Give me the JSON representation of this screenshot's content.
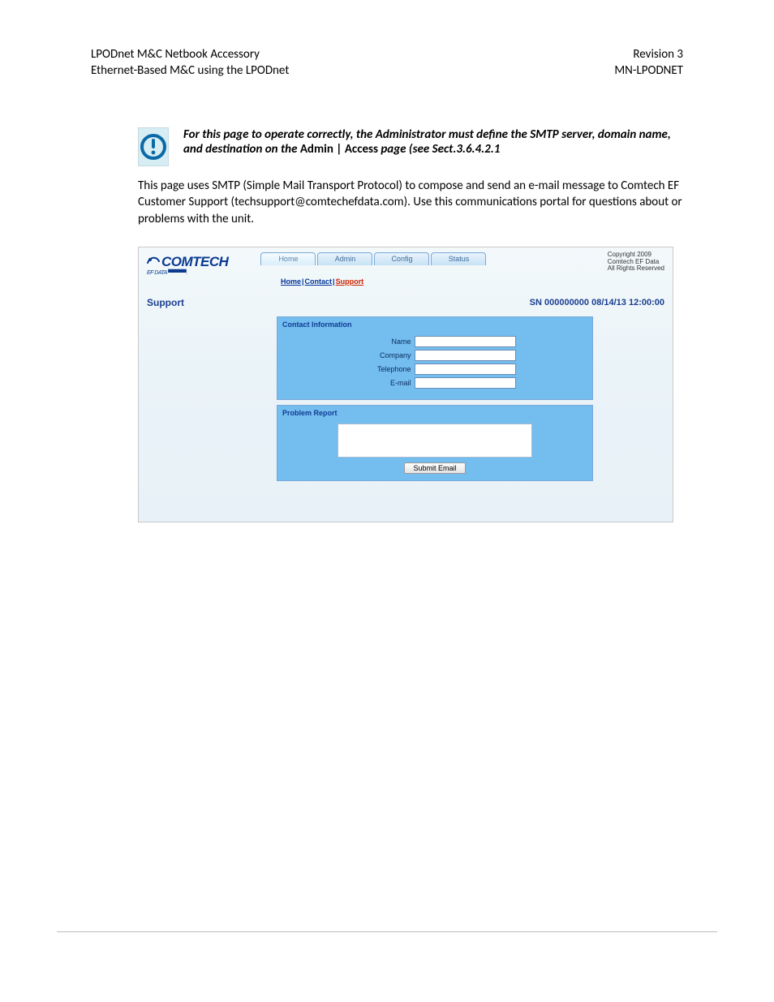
{
  "doc_header": {
    "left_line1": "LPODnet M&C Netbook Accessory",
    "left_line2": "Ethernet-Based M&C using the LPODnet",
    "right_line1": "Revision 3",
    "right_line2": "MN-LPODNET"
  },
  "note": {
    "part_a_italic_bold": "For this page to operate correctly, the Administrator must define the SMTP server, domain name, and destination on the ",
    "part_b_bold": "Admin | Access",
    "part_c_italic_bold": " page (see Sect.3.6.4.2.1"
  },
  "paragraph": "This page uses SMTP (Simple Mail Transport Protocol) to compose and send an e-mail message to Comtech EF Customer Support (techsupport@comtechefdata.com). Use this communications portal for questions about or problems with the unit.",
  "app": {
    "logo_main": "COMTECH",
    "logo_sub": "EF DATA ▀▀▀▀▀.",
    "tabs": [
      "Home",
      "Admin",
      "Config",
      "Status"
    ],
    "tabs_active_index": 0,
    "copyright": {
      "l1": "Copyright 2009",
      "l2": "Comtech EF Data",
      "l3": "All Rights Reserved"
    },
    "sub_tabs": [
      "Home",
      "Contact",
      "Support"
    ],
    "sub_tabs_active_index": 2,
    "page_title": "Support",
    "sn_line": "SN 000000000 08/14/13 12:00:00",
    "panel_contact": {
      "legend": "Contact Information",
      "fields": {
        "name": {
          "label": "Name",
          "value": ""
        },
        "company": {
          "label": "Company",
          "value": ""
        },
        "telephone": {
          "label": "Telephone",
          "value": ""
        },
        "email": {
          "label": "E-mail",
          "value": ""
        }
      }
    },
    "panel_report": {
      "legend": "Problem Report",
      "textarea_value": "",
      "submit_label": "Submit Email"
    }
  }
}
